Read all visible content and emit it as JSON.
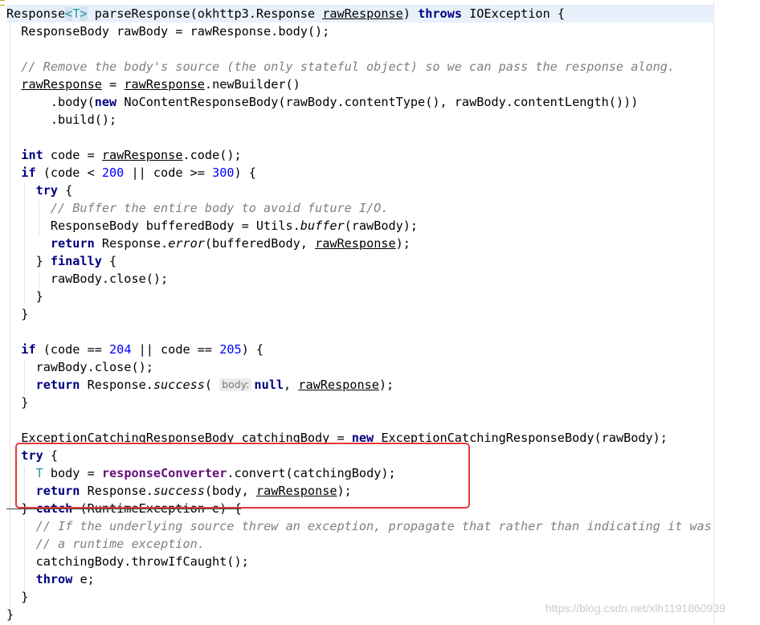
{
  "editor": {
    "language": "Java",
    "method_name": "parseResponse",
    "highlight_box_color": "#e2393a",
    "colors": {
      "keyword": "#000080",
      "number": "#0000ff",
      "comment": "#808080",
      "type_param": "#20999d",
      "field": "#660e7a"
    }
  },
  "code": {
    "l1": {
      "a": "Response",
      "lt": "<",
      "t": "T",
      "gt": ">",
      "b": " parseResponse(okhttp3.Response ",
      "raw": "rawResponse",
      "c": ") ",
      "throws": "throws",
      "d": " IOException {"
    },
    "l2": "  ResponseBody rawBody = rawResponse.body();",
    "l4": "  // Remove the body's source (the only stateful object) so we can pass the response along.",
    "l5": {
      "raw1": "rawResponse",
      "a": " = ",
      "raw2": "rawResponse",
      "b": ".newBuilder()"
    },
    "l6": {
      "a": "      .body(",
      "new": "new",
      "b": " NoContentResponseBody(rawBody.contentType(), rawBody.contentLength()))"
    },
    "l7": "      .build();",
    "l9": {
      "int": "int",
      "a": " code = ",
      "raw": "rawResponse",
      "b": ".code();"
    },
    "l10": {
      "if": "if",
      "a": " (code < ",
      "n1": "200",
      "b": " || code >= ",
      "n2": "300",
      "c": ") {"
    },
    "l11": {
      "try": "try",
      "a": " {"
    },
    "l12": "      // Buffer the entire body to avoid future I/O.",
    "l13": {
      "a": "      ResponseBody bufferedBody = Utils.",
      "buf": "buffer",
      "b": "(rawBody);"
    },
    "l14": {
      "ret": "return",
      "a": " Response.",
      "err": "error",
      "b": "(bufferedBody, ",
      "raw": "rawResponse",
      "c": ");"
    },
    "l15": {
      "a": "    } ",
      "fin": "finally",
      "b": " {"
    },
    "l16": "      rawBody.close();",
    "l17": "    }",
    "l18": "  }",
    "l20": {
      "if": "if",
      "a": " (code == ",
      "n1": "204",
      "b": " || code == ",
      "n2": "205",
      "c": ") {"
    },
    "l21": "    rawBody.close();",
    "l22": {
      "ret": "return",
      "a": " Response.",
      "suc": "success",
      "b": "( ",
      "hint": "body:",
      "null": "null",
      "c": ", ",
      "raw": "rawResponse",
      "d": ");"
    },
    "l23": "  }",
    "l25": {
      "a": "  ExceptionCatchingResponseBody catchingBody = ",
      "new": "new",
      "b": " ExceptionCatchingResponseBody(rawBody);"
    },
    "l26": {
      "try": "try",
      "a": " {"
    },
    "l27": {
      "t": "T",
      "a": " body = ",
      "fld": "responseConverter",
      "b": ".convert(catchingBody);"
    },
    "l28": {
      "ret": "return",
      "a": " Response.",
      "suc": "success",
      "b": "(body, ",
      "raw": "rawResponse",
      "c": ");"
    },
    "l29": {
      "a": "  } ",
      "catch": "catch",
      "b": " (RuntimeException e) {"
    },
    "l30": "    // If the underlying source threw an exception, propagate that rather than indicating it was",
    "l31": "    // a runtime exception.",
    "l32": "    catchingBody.throwIfCaught();",
    "l33": {
      "throw": "throw",
      "a": " e;"
    },
    "l34": "  }",
    "l35": "}"
  },
  "watermark": "https://blog.csdn.net/xlh1191860939"
}
